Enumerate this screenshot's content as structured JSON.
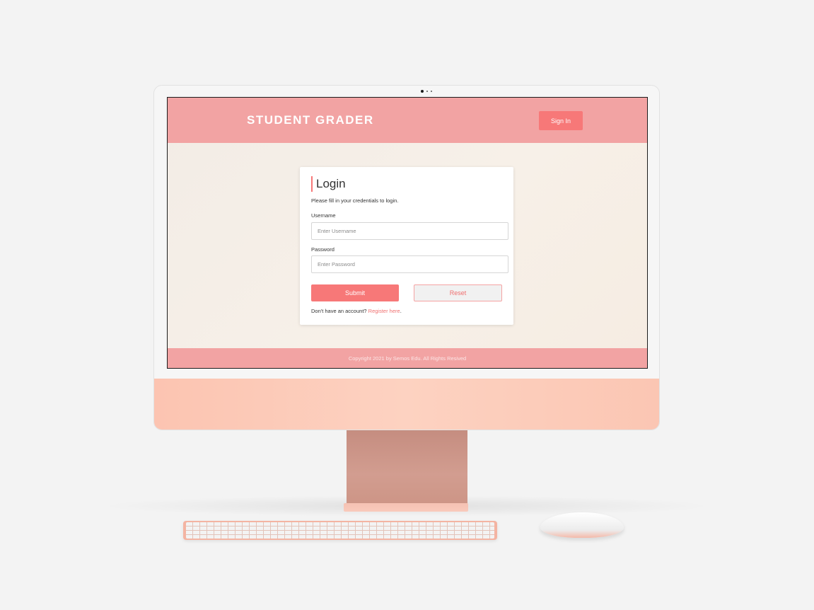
{
  "app": {
    "brand": "STUDENT GRADER",
    "signin_label": "Sign In"
  },
  "login": {
    "title": "Login",
    "subtitle": "Please fill in your credentials to login.",
    "username_label": "Username",
    "username_placeholder": "Enter Username",
    "password_label": "Password",
    "password_placeholder": "Enter Password",
    "submit_label": "Submit",
    "reset_label": "Reset",
    "register_prompt": "Don't have an account?",
    "register_link": "Register here",
    "register_suffix": "."
  },
  "footer": {
    "copyright": "Copyright 2021 by Semos Edu. All Rights Resived"
  },
  "colors": {
    "header": "#f2a3a3",
    "accent": "#f77878",
    "monitor_chin": "#fdd2c1",
    "stand": "#c58d80"
  }
}
